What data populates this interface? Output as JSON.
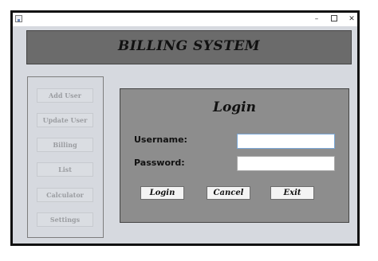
{
  "window": {
    "controls": {
      "minimize": "–",
      "close": "✕"
    }
  },
  "header": {
    "title": "BILLING  SYSTEM"
  },
  "sidebar": {
    "items": [
      {
        "label": "Add User"
      },
      {
        "label": "Update User"
      },
      {
        "label": "Billing"
      },
      {
        "label": "List"
      },
      {
        "label": "Calculator"
      },
      {
        "label": "Settings"
      }
    ]
  },
  "login": {
    "title": "Login",
    "username_label": "Username:",
    "username_value": "",
    "password_label": "Password:",
    "password_value": "",
    "buttons": {
      "login": "Login",
      "cancel": "Cancel",
      "exit": "Exit"
    }
  },
  "colors": {
    "window_bg": "#d6d9df",
    "header_bg": "#6b6b6b",
    "login_panel_bg": "#8d8d8d",
    "disabled_text": "#9b9da1"
  }
}
